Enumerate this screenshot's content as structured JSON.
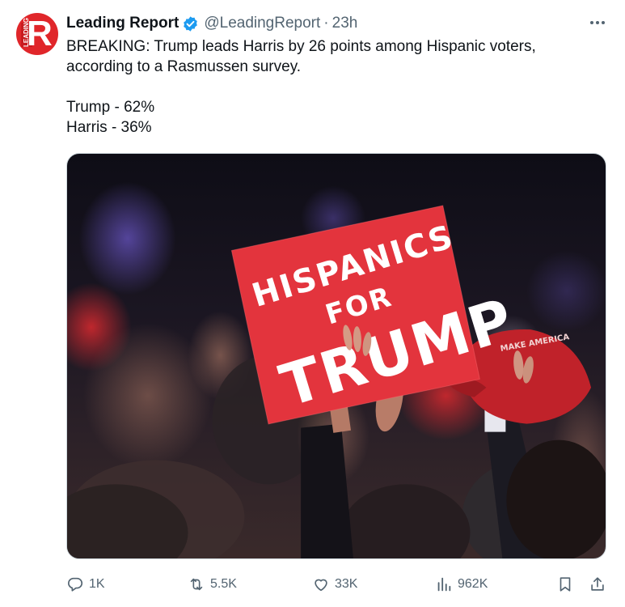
{
  "account": {
    "name": "Leading Report",
    "handle": "@LeadingReport",
    "separator": "·",
    "time": "23h",
    "avatar_letter": "R",
    "avatar_tag": "LEADING"
  },
  "tweet": {
    "line1": "BREAKING: Trump leads Harris by 26 points among Hispanic voters, according to a Rasmussen survey.",
    "line2": "Trump - 62%",
    "line3": "Harris - 36%"
  },
  "photo": {
    "sign_line1": "HISPANICS",
    "sign_line2": "FOR",
    "sign_line3": "TRUMP",
    "cap_text": "MAKE AMERICA"
  },
  "actions": {
    "replies": "1K",
    "reposts": "5.5K",
    "likes": "33K",
    "views": "962K"
  },
  "colors": {
    "brand_red": "#e0262a",
    "verified_blue": "#1d9bf0",
    "muted": "#536471",
    "sign_red": "#e3343d"
  },
  "icons": {
    "verified": "verified-badge-icon",
    "more": "more-icon",
    "reply": "reply-icon",
    "repost": "repost-icon",
    "like": "heart-icon",
    "views": "views-icon",
    "bookmark": "bookmark-icon",
    "share": "share-icon"
  }
}
